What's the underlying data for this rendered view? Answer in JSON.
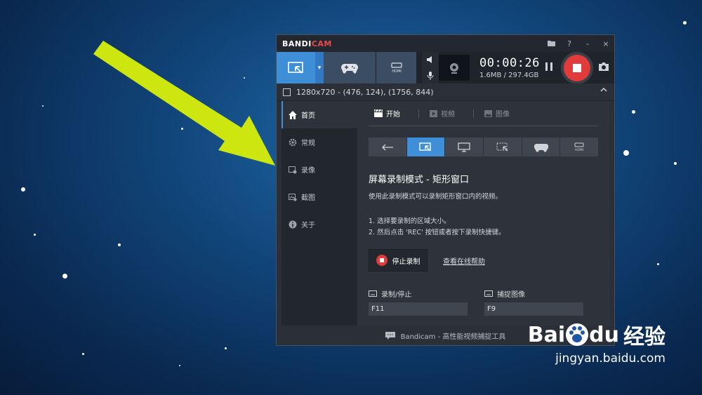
{
  "app": {
    "logo_prefix": "BANDI",
    "logo_suffix": "CAM",
    "title_buttons": [
      "folder",
      "?",
      "-",
      "×"
    ]
  },
  "toolbar": {
    "timer": "00:00:26",
    "storage": "1.6MB / 297.4GB"
  },
  "infobar": {
    "region": "1280x720 - (476, 124), (1756, 844)"
  },
  "sidebar": {
    "items": [
      {
        "label": "首页",
        "icon": "home-icon"
      },
      {
        "label": "常规",
        "icon": "gear-icon"
      },
      {
        "label": "录像",
        "icon": "video-icon"
      },
      {
        "label": "截图",
        "icon": "image-icon"
      },
      {
        "label": "关于",
        "icon": "info-icon"
      }
    ]
  },
  "tabs": [
    {
      "label": "开始",
      "icon": "clapper-icon"
    },
    {
      "label": "视频",
      "icon": "play-icon"
    },
    {
      "label": "图像",
      "icon": "picture-icon"
    }
  ],
  "content": {
    "heading": "屏幕录制模式 - 矩形窗口",
    "description": "使用此录制模式可以录制矩形窗口内的视频。",
    "step1": "1. 选择要录制的区域大小。",
    "step2": "2. 然后点击 'REC' 按钮或者按下录制快捷键。",
    "stop_button": "停止录制",
    "help_link": "查看在线帮助",
    "hotkey_record_label": "录制/停止",
    "hotkey_record_value": "F11",
    "hotkey_capture_label": "捕捉图像",
    "hotkey_capture_value": "F9"
  },
  "footer": {
    "text": "Bandicam - 高性能视频捕捉工具"
  },
  "watermark": {
    "brand": "Bai",
    "brand2": "du",
    "cn": "经验",
    "url": "jingyan.baidu.com"
  },
  "colors": {
    "accent": "#3f8ed8",
    "record": "#e23b3b",
    "arrow": "#cde60f"
  }
}
